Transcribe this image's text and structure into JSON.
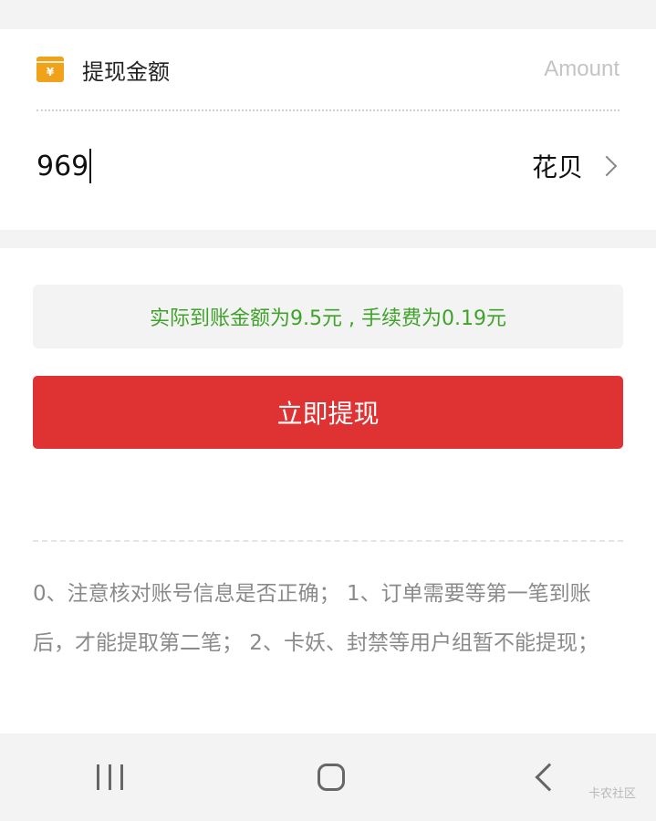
{
  "withdraw": {
    "title": "提现金额",
    "amount_placeholder": "Amount",
    "amount_value": "969",
    "method": "花贝",
    "icon_symbol": "¥"
  },
  "info": {
    "text": "实际到账金额为9.5元 , 手续费为0.19元",
    "color": "#3fa32a"
  },
  "submit": {
    "label": "立即提现",
    "color": "#df3232"
  },
  "notes": "0、注意核对账号信息是否正确； 1、订单需要等第一笔到账后，才能提取第二笔； 2、卡妖、封禁等用户组暂不能提现；",
  "watermark": "卡农社区",
  "icons": [
    "wallet-icon",
    "chevron-right-icon",
    "recents-icon",
    "home-icon",
    "back-icon"
  ]
}
